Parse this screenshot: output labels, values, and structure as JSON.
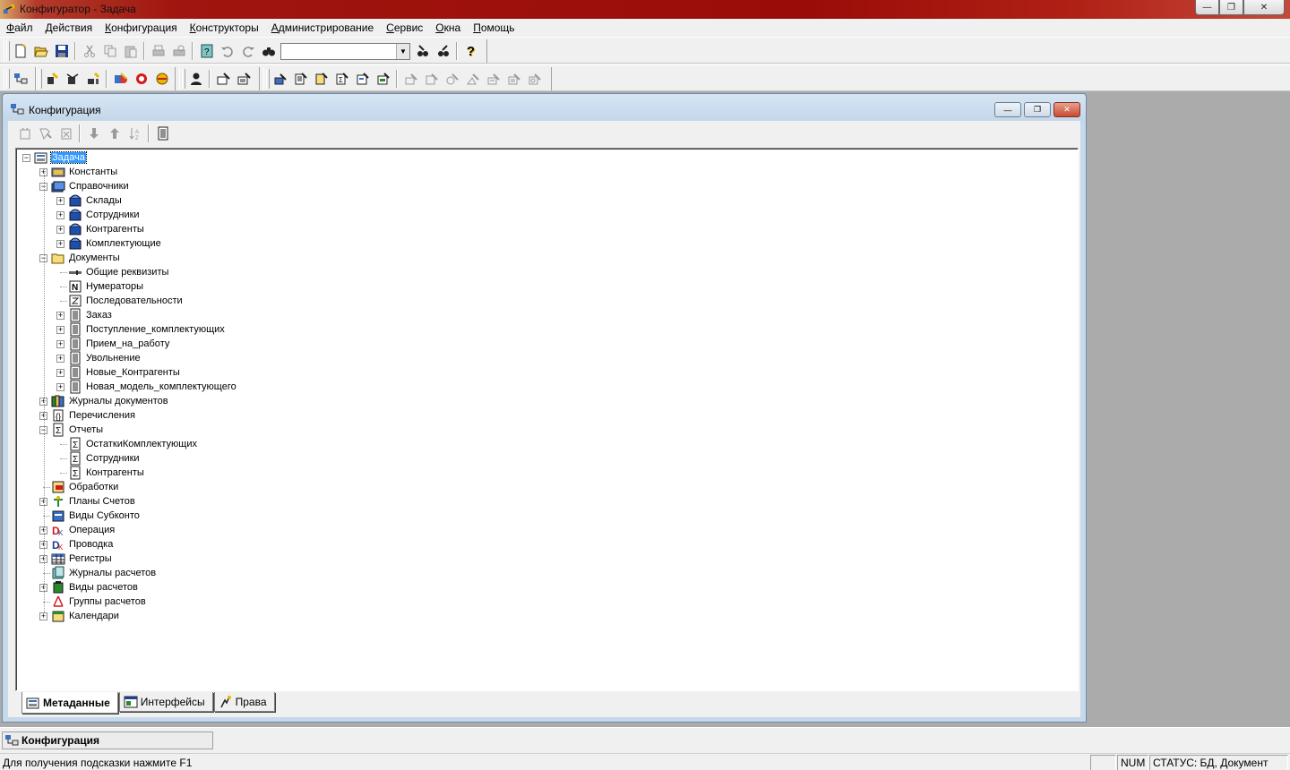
{
  "window": {
    "title": "Конфигуратор - Задача",
    "controls": {
      "minimize": "—",
      "restore": "❐",
      "close": "✕"
    }
  },
  "menu": [
    {
      "label": "Файл",
      "underline": "Ф",
      "rest": "айл"
    },
    {
      "label": "Действия",
      "underline": "Д",
      "rest": "ействия"
    },
    {
      "label": "Конфигурация",
      "underline": "К",
      "rest": "онфигурация"
    },
    {
      "label": "Конструкторы",
      "underline": "К",
      "rest": "онструкторы"
    },
    {
      "label": "Администрирование",
      "underline": "А",
      "rest": "дминистрирование"
    },
    {
      "label": "Сервис",
      "underline": "С",
      "rest": "ервис"
    },
    {
      "label": "Окна",
      "underline": "О",
      "rest": "кна"
    },
    {
      "label": "Помощь",
      "underline": "П",
      "rest": "омощь"
    }
  ],
  "toolbar": {
    "search_value": "",
    "help_glyph": "?"
  },
  "child_window": {
    "title": "Конфигурация",
    "controls": {
      "minimize": "—",
      "restore": "❐",
      "close": "✕"
    }
  },
  "tree": [
    {
      "label": "Задача",
      "level": 0,
      "expander": "−",
      "icon": "config-icon",
      "selected": true
    },
    {
      "label": "Константы",
      "level": 1,
      "expander": "+",
      "icon": "constants-icon"
    },
    {
      "label": "Справочники",
      "level": 1,
      "expander": "−",
      "icon": "catalogs-icon"
    },
    {
      "label": "Склады",
      "level": 2,
      "expander": "+",
      "icon": "catalog-icon"
    },
    {
      "label": "Сотрудники",
      "level": 2,
      "expander": "+",
      "icon": "catalog-icon"
    },
    {
      "label": "Контрагенты",
      "level": 2,
      "expander": "+",
      "icon": "catalog-icon"
    },
    {
      "label": "Комплектующие",
      "level": 2,
      "expander": "+",
      "icon": "catalog-icon"
    },
    {
      "label": "Документы",
      "level": 1,
      "expander": "−",
      "icon": "folder-icon"
    },
    {
      "label": "Общие реквизиты",
      "level": 2,
      "expander": "",
      "icon": "attribute-icon"
    },
    {
      "label": "Нумераторы",
      "level": 2,
      "expander": "",
      "icon": "numerator-icon"
    },
    {
      "label": "Последовательности",
      "level": 2,
      "expander": "",
      "icon": "sequence-icon"
    },
    {
      "label": "Заказ",
      "level": 2,
      "expander": "+",
      "icon": "document-icon"
    },
    {
      "label": "Поступление_комплектующих",
      "level": 2,
      "expander": "+",
      "icon": "document-icon"
    },
    {
      "label": "Прием_на_работу",
      "level": 2,
      "expander": "+",
      "icon": "document-icon"
    },
    {
      "label": "Увольнение",
      "level": 2,
      "expander": "+",
      "icon": "document-icon"
    },
    {
      "label": "Новые_Контрагенты",
      "level": 2,
      "expander": "+",
      "icon": "document-icon"
    },
    {
      "label": "Новая_модель_комплектующего",
      "level": 2,
      "expander": "+",
      "icon": "document-icon"
    },
    {
      "label": "Журналы документов",
      "level": 1,
      "expander": "+",
      "icon": "journal-icon"
    },
    {
      "label": "Перечисления",
      "level": 1,
      "expander": "+",
      "icon": "enum-icon"
    },
    {
      "label": "Отчеты",
      "level": 1,
      "expander": "−",
      "icon": "report-icon"
    },
    {
      "label": "ОстаткиКомплектующих",
      "level": 2,
      "expander": "",
      "icon": "report-icon"
    },
    {
      "label": "Сотрудники",
      "level": 2,
      "expander": "",
      "icon": "report-icon"
    },
    {
      "label": "Контрагенты",
      "level": 2,
      "expander": "",
      "icon": "report-icon"
    },
    {
      "label": "Обработки",
      "level": 1,
      "expander": "",
      "icon": "processing-icon"
    },
    {
      "label": "Планы Счетов",
      "level": 1,
      "expander": "+",
      "icon": "chart-of-accounts-icon"
    },
    {
      "label": "Виды Субконто",
      "level": 1,
      "expander": "",
      "icon": "subconto-icon"
    },
    {
      "label": "Операция",
      "level": 1,
      "expander": "+",
      "icon": "operation-icon"
    },
    {
      "label": "Проводка",
      "level": 1,
      "expander": "+",
      "icon": "entry-icon"
    },
    {
      "label": "Регистры",
      "level": 1,
      "expander": "+",
      "icon": "registers-icon"
    },
    {
      "label": "Журналы расчетов",
      "level": 1,
      "expander": "",
      "icon": "calc-journal-icon"
    },
    {
      "label": "Виды расчетов",
      "level": 1,
      "expander": "+",
      "icon": "calc-kinds-icon"
    },
    {
      "label": "Группы расчетов",
      "level": 1,
      "expander": "",
      "icon": "calc-groups-icon"
    },
    {
      "label": "Календари",
      "level": 1,
      "expander": "+",
      "icon": "calendar-icon"
    }
  ],
  "tabs": [
    {
      "label": "Метаданные",
      "active": true
    },
    {
      "label": "Интерфейсы",
      "active": false
    },
    {
      "label": "Права",
      "active": false
    }
  ],
  "taskstrip": {
    "label": "Конфигурация"
  },
  "status": {
    "hint": "Для получения подсказки нажмите F1",
    "pane_empty": "",
    "num": "NUM",
    "state": "СТАТУС: БД, Документ"
  }
}
